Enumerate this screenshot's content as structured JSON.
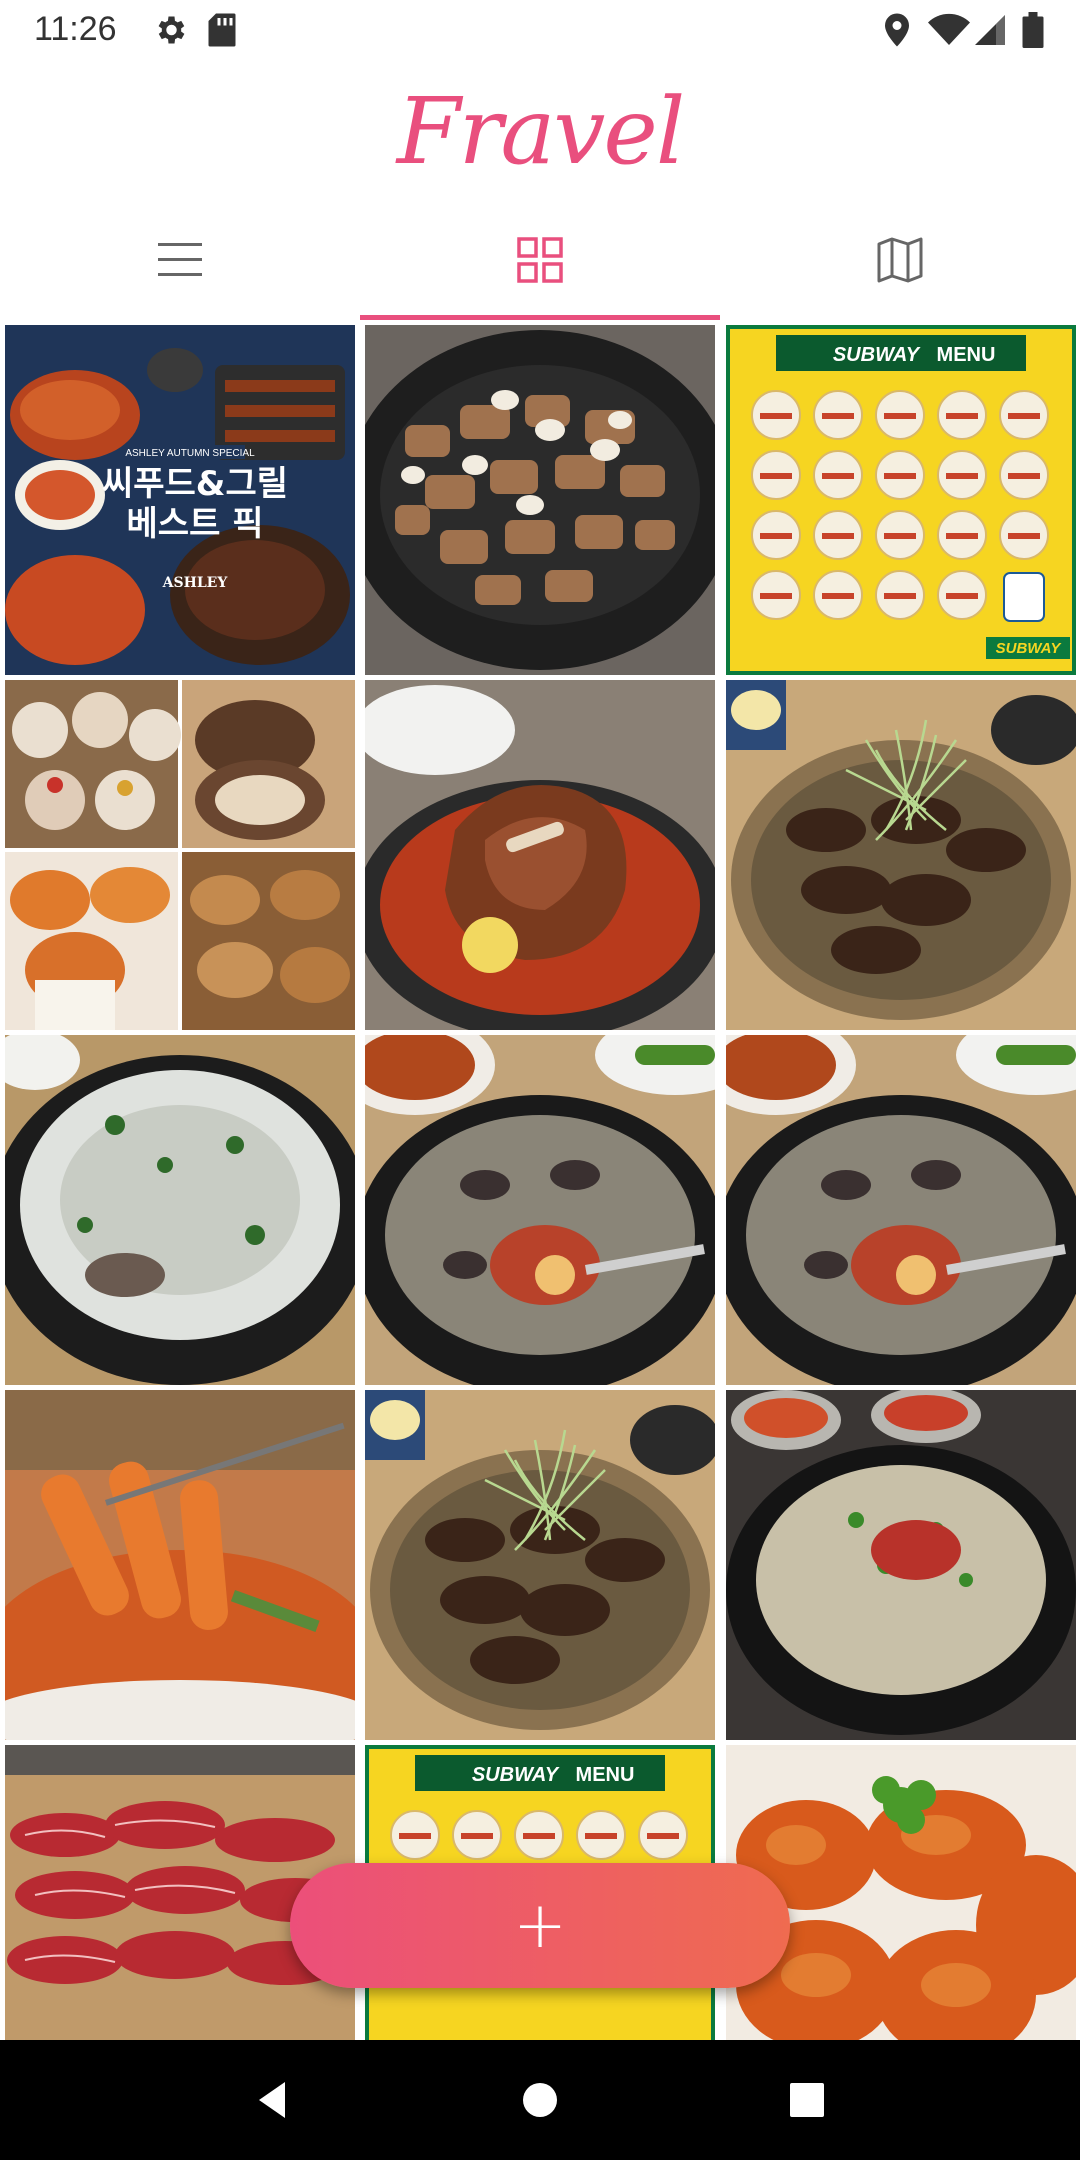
{
  "status_bar": {
    "time": "11:26",
    "left_icons": [
      "gear-icon",
      "sd-card-icon"
    ],
    "right_icons": [
      "location-icon",
      "wifi-icon",
      "signal-icon",
      "battery-icon"
    ]
  },
  "app": {
    "title": "Fravel",
    "accent_color": "#e94f7e"
  },
  "tabs": [
    {
      "icon": "list-icon",
      "selected": false
    },
    {
      "icon": "grid-icon",
      "selected": true
    },
    {
      "icon": "map-icon",
      "selected": false
    }
  ],
  "grid": {
    "columns": 3,
    "photos": [
      {
        "name": "photo-seafood-grill-poster",
        "text": {
          "main": "씨푸드&그릴",
          "sub": "베스트 픽",
          "brand": "ASHLEY",
          "tag": "ASHLEY AUTUMN SPECIAL"
        }
      },
      {
        "name": "photo-grilled-pork"
      },
      {
        "name": "photo-subway-menu",
        "text": {
          "brand": "SUBWAY",
          "menu": "MENU"
        }
      },
      {
        "name": "photo-bakery-collage"
      },
      {
        "name": "photo-braised-ribs"
      },
      {
        "name": "photo-bulgogi-scallion"
      },
      {
        "name": "photo-seolleongtang"
      },
      {
        "name": "photo-sundae-gukbap"
      },
      {
        "name": "photo-sundae-gukbap-2"
      },
      {
        "name": "photo-tteokbokki"
      },
      {
        "name": "photo-bulgogi-scallion-2"
      },
      {
        "name": "photo-dwaeji-gukbap"
      },
      {
        "name": "photo-raw-beef"
      },
      {
        "name": "photo-subway-menu-2",
        "text": {
          "brand": "SUBWAY",
          "menu": "MENU"
        }
      },
      {
        "name": "photo-spicy-chicken"
      }
    ]
  },
  "fab": {
    "label": "+",
    "gradient_start": "#ec4f7a",
    "gradient_end": "#ef6b50"
  },
  "nav_bar": {
    "buttons": [
      "back-icon",
      "home-icon",
      "recents-icon"
    ]
  }
}
